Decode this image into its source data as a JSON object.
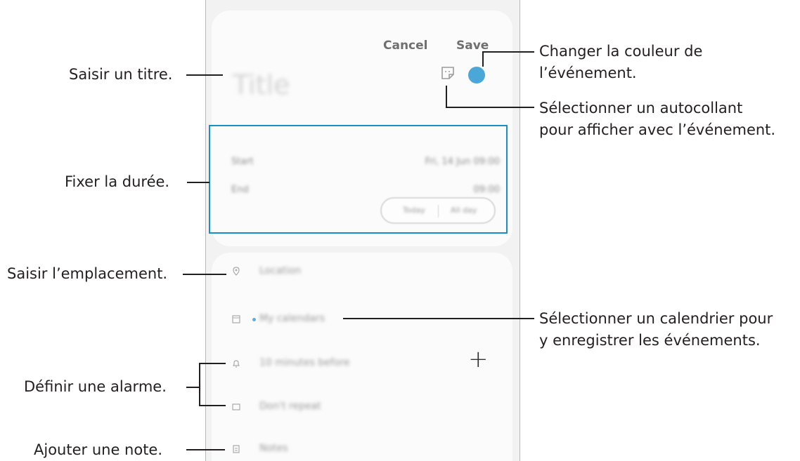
{
  "screen": {
    "cancel_label": "Cancel",
    "save_label": "Save",
    "title_placeholder": "Title",
    "start_label": "Start",
    "start_value": "Fri, 14 Jun 09:00",
    "end_label": "End",
    "end_value": "09:00",
    "today_label": "Today",
    "allday_label": "All day",
    "location_placeholder": "Location",
    "calendar_value": "My calendars",
    "alarm_value": "10 minutes before",
    "repeat_value": "Don't repeat",
    "notes_placeholder": "Notes",
    "event_color": "#4aa8d8"
  },
  "callouts": {
    "title": "Saisir un titre.",
    "duration": "Fixer la durée.",
    "location": "Saisir l’emplacement.",
    "alarm": "Définir une alarme.",
    "note": "Ajouter une note.",
    "color_line1": "Changer la couleur de",
    "color_line2": "l’événement.",
    "sticker_line1": "Sélectionner un autocollant",
    "sticker_line2": "pour afficher avec l’événement.",
    "calendar_line1": "Sélectionner un calendrier pour",
    "calendar_line2": "y enregistrer les événements."
  },
  "colors": {
    "highlight_box": "#1a8fc6",
    "phone_background": "#f2f2f2"
  }
}
